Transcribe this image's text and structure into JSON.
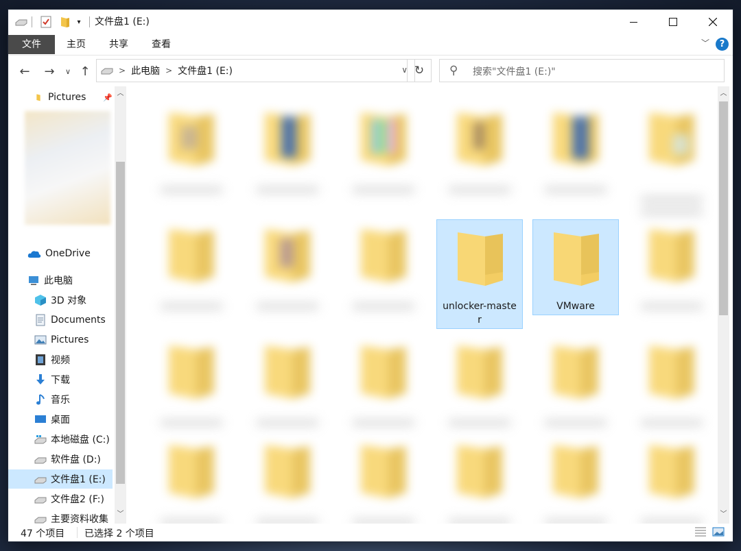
{
  "window": {
    "title": "文件盘1 (E:)",
    "controls": [
      "minimize",
      "maximize",
      "close"
    ]
  },
  "ribbon": {
    "tabs": [
      "文件",
      "主页",
      "共享",
      "查看"
    ],
    "help_label": "?"
  },
  "address": {
    "crumbs": [
      "此电脑",
      "文件盘1 (E:)"
    ],
    "separator": ">"
  },
  "search": {
    "placeholder": "搜索\"文件盘1 (E:)\""
  },
  "nav_pane": {
    "pinned": {
      "label": "Pictures"
    },
    "items": [
      {
        "label": "OneDrive",
        "icon": "onedrive-icon"
      },
      {
        "label": "此电脑",
        "icon": "pc-icon"
      },
      {
        "label": "3D 对象",
        "icon": "3d-objects-icon"
      },
      {
        "label": "Documents",
        "icon": "documents-icon"
      },
      {
        "label": "Pictures",
        "icon": "pictures-icon"
      },
      {
        "label": "视频",
        "icon": "video-icon"
      },
      {
        "label": "下载",
        "icon": "download-icon"
      },
      {
        "label": "音乐",
        "icon": "music-icon"
      },
      {
        "label": "桌面",
        "icon": "desktop-icon"
      },
      {
        "label": "本地磁盘 (C:)",
        "icon": "drive-icon"
      },
      {
        "label": "软件盘 (D:)",
        "icon": "drive-icon"
      },
      {
        "label": "文件盘1 (E:)",
        "icon": "drive-icon",
        "selected": true
      },
      {
        "label": "文件盘2 (F:)",
        "icon": "drive-icon"
      },
      {
        "label": "主要资料收集",
        "icon": "drive-icon"
      }
    ]
  },
  "content": {
    "visible_items": [
      {
        "name": "unlocker-master",
        "selected": true
      },
      {
        "name": "VMware",
        "selected": true
      }
    ]
  },
  "status": {
    "item_count": "47 个项目",
    "selection": "已选择 2 个项目"
  },
  "colors": {
    "selection_bg": "#cce8ff",
    "selection_border": "#99d1ff",
    "file_tab_bg": "#4a4a4a",
    "folder_yellow": "#f8d775",
    "help_blue": "#1979ca"
  }
}
